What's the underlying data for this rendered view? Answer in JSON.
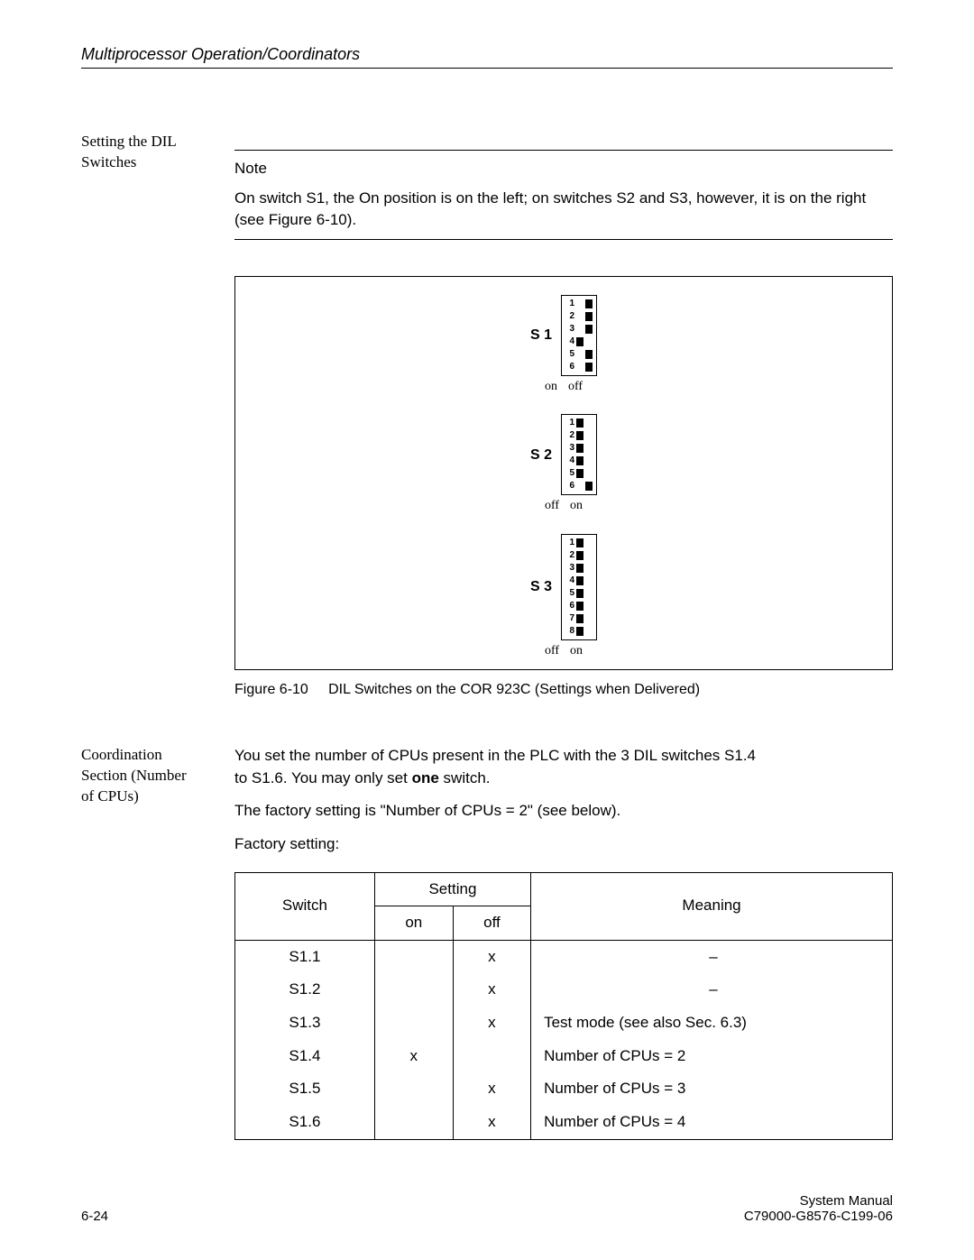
{
  "header": {
    "running_head": "Multiprocessor Operation/Coordinators"
  },
  "side1": {
    "line1": "Setting the DIL",
    "line2": "Switches"
  },
  "note": {
    "label": "Note",
    "body": "On switch S1, the On position is on the left; on switches S2 and S3, however, it is on the right (see Figure 6-10)."
  },
  "figure": {
    "s1_label": "S 1",
    "s2_label": "S 2",
    "s3_label": "S 3",
    "s1_on": "on",
    "s1_off": "off",
    "s2_off": "off",
    "s2_on": "on",
    "s3_off": "off",
    "s3_on": "on",
    "caption_num": "Figure 6-10",
    "caption_text": "DIL Switches on the COR 923C (Settings when Delivered)"
  },
  "side2": {
    "line1": "Coordination",
    "line2": "Section (Number",
    "line3": "of CPUs)"
  },
  "body2": {
    "p1a": "You set the number of CPUs present in the PLC with the 3 DIL switches S1.4",
    "p1b": "to S1.6. You may only set ",
    "p1c": "one",
    "p1d": " switch.",
    "p2": "The factory setting is \"Number of CPUs = 2\" (see below).",
    "p3": "Factory setting:"
  },
  "table": {
    "h_switch": "Switch",
    "h_setting": "Setting",
    "h_meaning": "Meaning",
    "h_on": "on",
    "h_off": "off",
    "rows": [
      {
        "sw": "S1.1",
        "on": "",
        "off": "x",
        "meaning": "–"
      },
      {
        "sw": "S1.2",
        "on": "",
        "off": "x",
        "meaning": "–"
      },
      {
        "sw": "S1.3",
        "on": "",
        "off": "x",
        "meaning": "Test mode (see also Sec. 6.3)"
      },
      {
        "sw": "S1.4",
        "on": "x",
        "off": "",
        "meaning": "Number of CPUs = 2"
      },
      {
        "sw": "S1.5",
        "on": "",
        "off": "x",
        "meaning": "Number of CPUs = 3"
      },
      {
        "sw": "S1.6",
        "on": "",
        "off": "x",
        "meaning": "Number of CPUs = 4"
      }
    ]
  },
  "footer": {
    "page": "6-24",
    "right1": "System Manual",
    "right2": "C79000-G8576-C199-06"
  },
  "chart_data": {
    "type": "table",
    "title": "DIL switch S1 factory settings (COR 923C)",
    "columns": [
      "Switch",
      "on",
      "off",
      "Meaning"
    ],
    "rows": [
      [
        "S1.1",
        "",
        "x",
        "–"
      ],
      [
        "S1.2",
        "",
        "x",
        "–"
      ],
      [
        "S1.3",
        "",
        "x",
        "Test mode (see also Sec. 6.3)"
      ],
      [
        "S1.4",
        "x",
        "",
        "Number of CPUs = 2"
      ],
      [
        "S1.5",
        "",
        "x",
        "Number of CPUs = 3"
      ],
      [
        "S1.6",
        "",
        "x",
        "Number of CPUs = 4"
      ]
    ],
    "dip_switches": {
      "S1": {
        "count": 6,
        "on_side": "left",
        "positions": [
          "off",
          "off",
          "off",
          "on",
          "off",
          "off"
        ]
      },
      "S2": {
        "count": 6,
        "on_side": "right",
        "positions": [
          "off",
          "off",
          "off",
          "off",
          "off",
          "on"
        ]
      },
      "S3": {
        "count": 8,
        "on_side": "right",
        "positions": [
          "off",
          "off",
          "off",
          "off",
          "off",
          "off",
          "off",
          "off"
        ]
      }
    }
  }
}
